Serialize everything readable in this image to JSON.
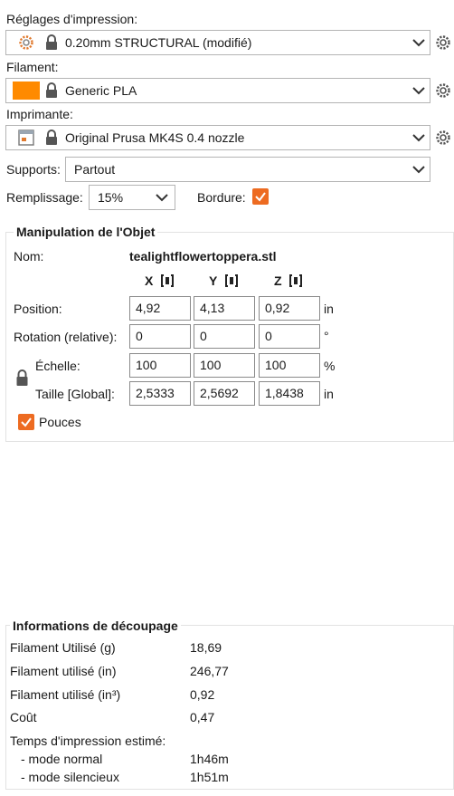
{
  "print_settings": {
    "label": "Réglages d'impression:",
    "value": "0.20mm STRUCTURAL (modifié)"
  },
  "filament": {
    "label": "Filament:",
    "value": "Generic PLA",
    "color": "#ff8a00"
  },
  "printer": {
    "label": "Imprimante:",
    "value": "Original Prusa MK4S 0.4 nozzle"
  },
  "supports": {
    "label": "Supports:",
    "value": "Partout"
  },
  "infill": {
    "label": "Remplissage:",
    "value": "15%"
  },
  "brim": {
    "label": "Bordure:",
    "checked": true
  },
  "accent_color": "#ed6b21",
  "object_manip": {
    "title": "Manipulation de l'Objet",
    "name_label": "Nom:",
    "name_value": "tealightflowertoppera.stl",
    "axes": [
      "X",
      "Y",
      "Z"
    ],
    "position": {
      "label": "Position:",
      "x": "4,92",
      "y": "4,13",
      "z": "0,92",
      "unit": "in"
    },
    "rotation": {
      "label": "Rotation (relative):",
      "x": "0",
      "y": "0",
      "z": "0",
      "unit": "°"
    },
    "scale": {
      "label": "Échelle:",
      "x": "100",
      "y": "100",
      "z": "100",
      "unit": "%"
    },
    "size": {
      "label": "Taille [Global]:",
      "x": "2,5333",
      "y": "2,5692",
      "z": "1,8438",
      "unit": "in"
    },
    "inches": {
      "label": "Pouces",
      "checked": true
    }
  },
  "slice_info": {
    "title": "Informations de découpage",
    "rows": [
      {
        "label": "Filament Utilisé (g)",
        "value": "18,69"
      },
      {
        "label": "Filament utilisé (in)",
        "value": "246,77"
      },
      {
        "label": "Filament utilisé (in³)",
        "value": "0,92"
      },
      {
        "label": "Coût",
        "value": "0,47"
      }
    ],
    "time_label": "Temps d'impression estimé:",
    "normal_label": "- mode normal",
    "normal_value": "1h46m",
    "silent_label": "- mode silencieux",
    "silent_value": "1h51m"
  }
}
